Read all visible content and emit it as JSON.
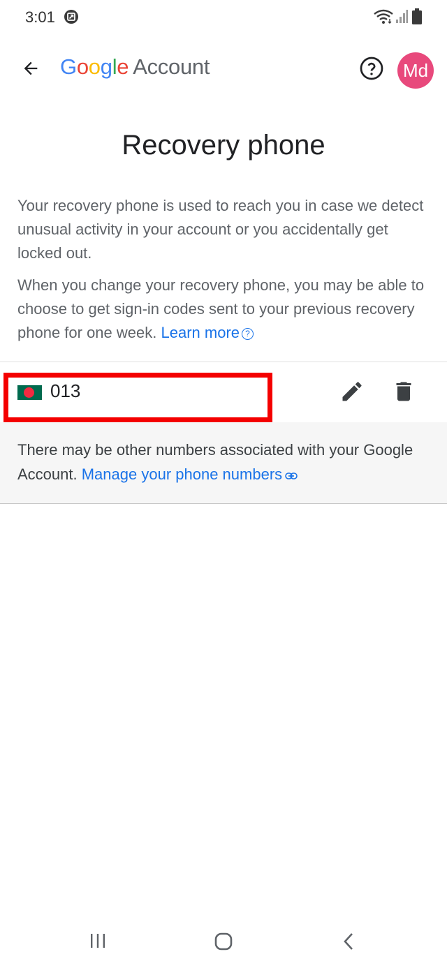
{
  "status_bar": {
    "time": "3:01",
    "icons": [
      "notification-icon",
      "wifi-icon",
      "signal-icon",
      "battery-icon"
    ]
  },
  "header": {
    "back_icon": "arrow-back-icon",
    "brand_letters": [
      "G",
      "o",
      "o",
      "g",
      "l",
      "e"
    ],
    "brand_suffix": "Account",
    "help_icon": "help-circle-icon",
    "avatar_initials": "Md",
    "avatar_color": "#e8497c"
  },
  "page": {
    "title": "Recovery phone",
    "description_1": "Your recovery phone is used to reach you in case we detect unusual activity in your account or you accidentally get locked out.",
    "description_2": "When you change your recovery phone, you may be able to choose to get sign-in codes sent to your previous recovery phone for one week.",
    "learn_more_link": "Learn more",
    "learn_more_icon": "?"
  },
  "phone_entry": {
    "flag": "bangladesh-flag-icon",
    "number": "013",
    "edit_icon": "pencil-icon",
    "delete_icon": "trash-icon",
    "highlight_color": "#f40000"
  },
  "info": {
    "text": "There may be other numbers associated with your Google Account.",
    "link": "Manage your phone numbers",
    "link_icon": "link-icon"
  },
  "nav_bar": {
    "buttons": [
      "recent-apps-icon",
      "home-icon",
      "back-icon"
    ]
  },
  "colors": {
    "link": "#1a73e8",
    "text": "#202124",
    "secondary_text": "#5f6368"
  }
}
